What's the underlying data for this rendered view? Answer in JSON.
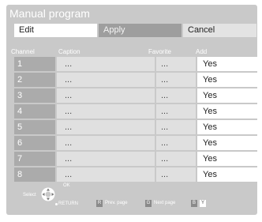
{
  "title": "Manual program",
  "buttons": {
    "edit": "Edit",
    "apply": "Apply",
    "cancel": "Cancel"
  },
  "columns": {
    "channel": "Channel",
    "caption": "Caption",
    "favorite": "Favorite",
    "add": "Add"
  },
  "rows": [
    {
      "channel": "1",
      "caption": "...",
      "favorite": "...",
      "add": "Yes"
    },
    {
      "channel": "2",
      "caption": "...",
      "favorite": "...",
      "add": "Yes"
    },
    {
      "channel": "3",
      "caption": "...",
      "favorite": "...",
      "add": "Yes"
    },
    {
      "channel": "4",
      "caption": "...",
      "favorite": "...",
      "add": "Yes"
    },
    {
      "channel": "5",
      "caption": "...",
      "favorite": "...",
      "add": "Yes"
    },
    {
      "channel": "6",
      "caption": "...",
      "favorite": "...",
      "add": "Yes"
    },
    {
      "channel": "7",
      "caption": "...",
      "favorite": "...",
      "add": "Yes"
    },
    {
      "channel": "8",
      "caption": "...",
      "favorite": "...",
      "add": "Yes"
    }
  ],
  "footer": {
    "select": "Select",
    "ok": "OK",
    "return": "RETURN",
    "key_r": "R",
    "prev_page": "Prev. page",
    "key_g": "G",
    "next_page": "Next page",
    "key_b": "B",
    "key_y": "Y"
  },
  "icons": {
    "navigation": "dpad-icon",
    "return": "return-dot-icon"
  },
  "colors": {
    "panel": "#c9c9c9",
    "selected_button": "#ffffff",
    "channel_cell": "#ababab",
    "add_cell": "#ffffff"
  }
}
